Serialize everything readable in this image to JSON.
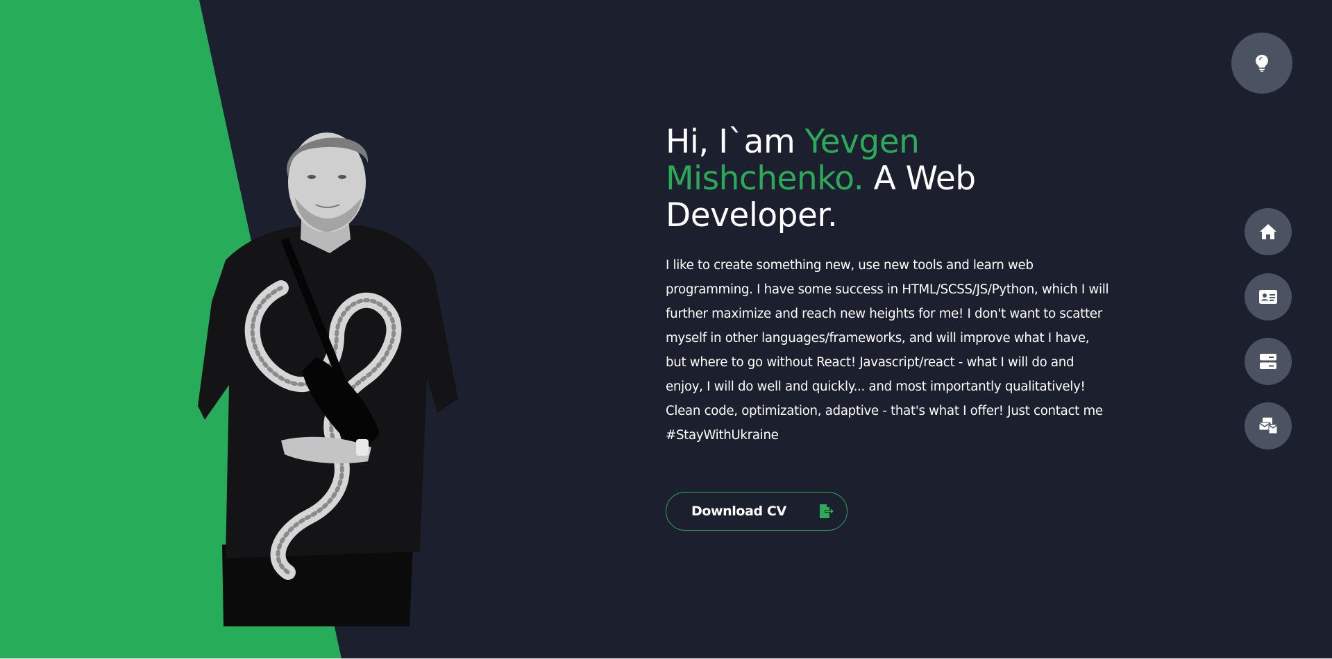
{
  "hero": {
    "title_prefix": "Hi, I`am ",
    "title_name": "Yevgen Mishchenko.",
    "title_suffix": " A Web Developer.",
    "description": "I like to create something new, use new tools and learn web programming. I have some success in HTML/SCSS/JS/Python, which I will further maximize and reach new heights for me! I don't want to scatter myself in other languages/frameworks, and will improve what I have, but where to go without React! Javascript/react - what I will do and enjoy, I will do well and quickly... and most importantly qualitatively! Clean code, optimization, adaptive - that's what I offer! Just contact me #StayWithUkraine",
    "cv_button_label": "Download CV",
    "cv_button_icon": "file-export-icon"
  },
  "theme_toggle": {
    "icon": "lightbulb-icon"
  },
  "nav": {
    "items": [
      {
        "id": "home",
        "icon": "home-icon"
      },
      {
        "id": "about",
        "icon": "id-card-icon"
      },
      {
        "id": "portfolio",
        "icon": "server-icon"
      },
      {
        "id": "contact",
        "icon": "mail-bulk-icon"
      }
    ]
  },
  "colors": {
    "background": "#1c1f2e",
    "accent": "#2bab58",
    "button_bg": "#4b5363",
    "icon_fg": "#ffffff",
    "text": "#ffffff"
  }
}
